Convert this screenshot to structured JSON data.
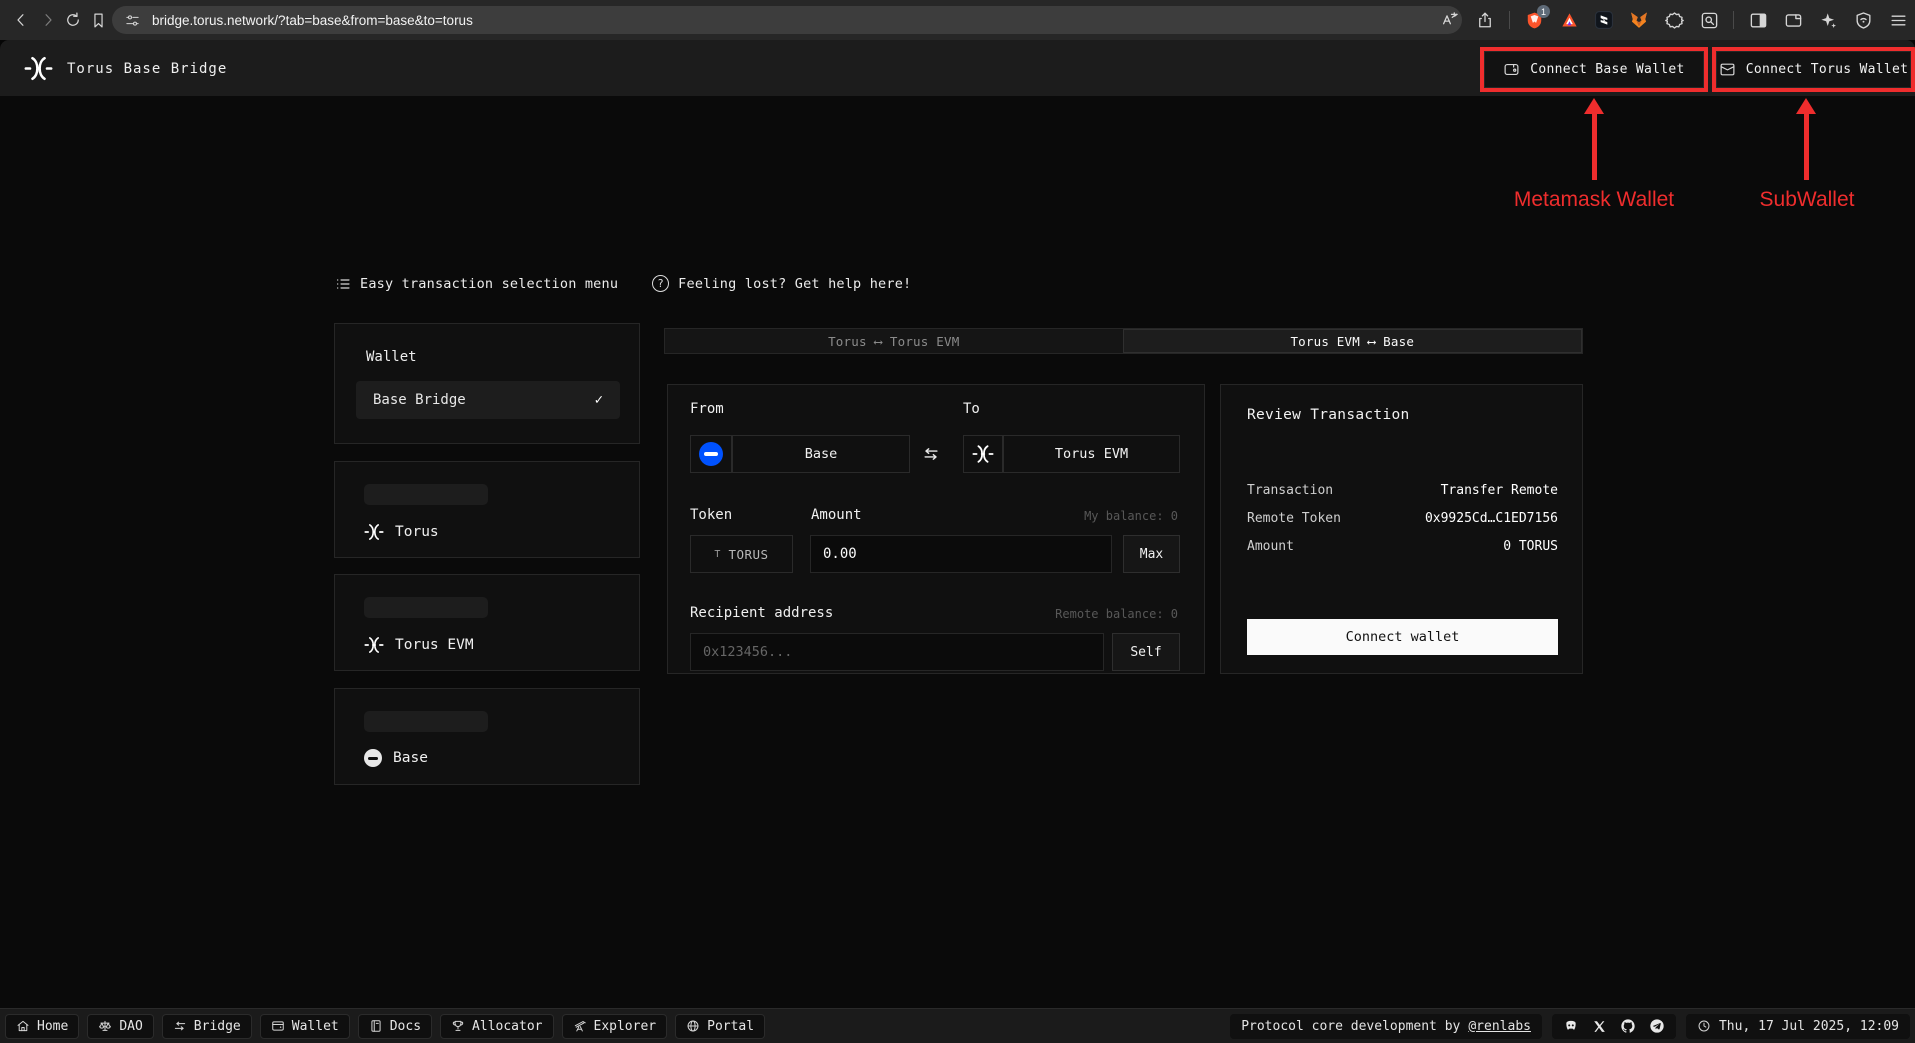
{
  "browser": {
    "url": "bridge.torus.network/?tab=base&from=base&to=torus",
    "shield_badge": "1"
  },
  "header": {
    "title": "Torus Base Bridge",
    "connect_base_label": "Connect Base Wallet",
    "connect_torus_label": "Connect Torus Wallet"
  },
  "annotations": {
    "metamask_label": "Metamask Wallet",
    "subwallet_label": "SubWallet",
    "accent_color": "#ef2d2d"
  },
  "helper": {
    "menu_label": "Easy transaction selection menu",
    "help_label": "Feeling lost? Get help here!"
  },
  "sidebar": {
    "wallet_card": {
      "title": "Wallet",
      "selected_item": "Base Bridge",
      "check_icon": "✓"
    },
    "networks": [
      {
        "name": "Torus"
      },
      {
        "name": "Torus EVM"
      },
      {
        "name": "Base"
      }
    ]
  },
  "tabs": [
    {
      "label": "Torus ⟷ Torus EVM",
      "active": false
    },
    {
      "label": "Torus EVM ⟷ Base",
      "active": true
    }
  ],
  "form": {
    "from_label": "From",
    "from_network": "Base",
    "to_label": "To",
    "to_network": "Torus EVM",
    "token_label": "Token",
    "token_prefix": "T",
    "token_symbol": "TORUS",
    "amount_label": "Amount",
    "amount_value": "0.00",
    "my_balance": "My balance: 0",
    "max_label": "Max",
    "recipient_label": "Recipient address",
    "remote_balance": "Remote balance: 0",
    "recipient_placeholder": "0x123456...",
    "self_label": "Self"
  },
  "review": {
    "title": "Review Transaction",
    "rows": [
      {
        "label": "Transaction",
        "value": "Transfer Remote"
      },
      {
        "label": "Remote Token",
        "value": "0x9925Cd…C1ED7156"
      },
      {
        "label": "Amount",
        "value": "0 TORUS"
      }
    ],
    "connect_label": "Connect wallet"
  },
  "footer": {
    "nav": [
      {
        "label": "Home"
      },
      {
        "label": "DAO"
      },
      {
        "label": "Bridge"
      },
      {
        "label": "Wallet"
      },
      {
        "label": "Docs"
      },
      {
        "label": "Allocator"
      },
      {
        "label": "Explorer"
      },
      {
        "label": "Portal"
      }
    ],
    "credit_text": "Protocol core development by ",
    "credit_link": "@renlabs",
    "datetime": "Thu, 17 Jul 2025, 12:09"
  },
  "colors": {
    "base_blue": "#0052ff",
    "annotation_red": "#ef2d2d",
    "page_bg": "#0a0a0a",
    "header_bg": "#1c1c1c"
  }
}
